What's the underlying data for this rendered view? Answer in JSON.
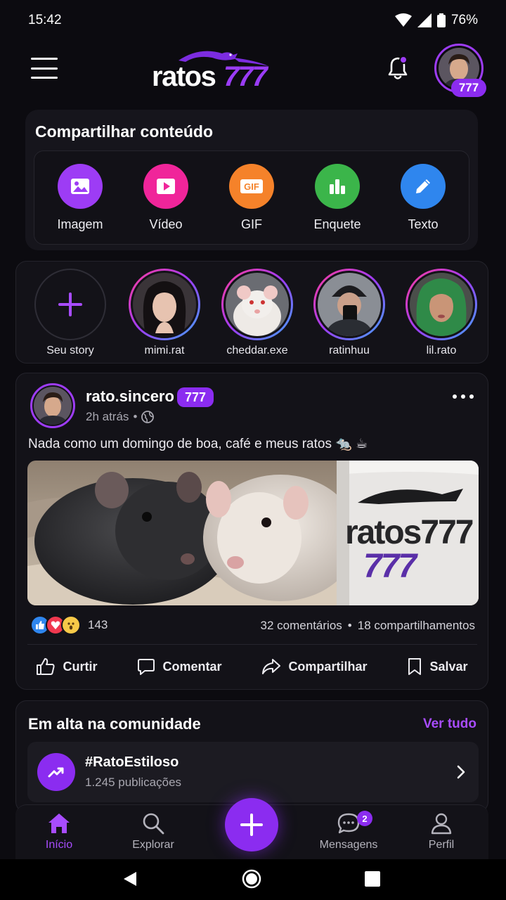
{
  "status_bar": {
    "time": "15:42",
    "battery": "76%"
  },
  "header": {
    "brand": "ratos777",
    "level": "777",
    "notification_dot": true
  },
  "share": {
    "title": "Compartilhar conteúdo",
    "options": [
      {
        "label": "Imagem",
        "icon": "image-icon",
        "color": "#9d3cf5"
      },
      {
        "label": "Vídeo",
        "icon": "play-icon",
        "color": "#f0259a"
      },
      {
        "label": "GIF",
        "icon": "gif-icon",
        "color": "#f5822a"
      },
      {
        "label": "Enquete",
        "icon": "bar-chart-icon",
        "color": "#3bb54a"
      },
      {
        "label": "Texto",
        "icon": "pencil-icon",
        "color": "#2f86ee"
      }
    ]
  },
  "stories": [
    {
      "label": "Seu story"
    },
    {
      "label": "mimi.rat"
    },
    {
      "label": "cheddar.exe"
    },
    {
      "label": "ratinhuu"
    },
    {
      "label": "lil.rato"
    }
  ],
  "post": {
    "username": "rato.sincero",
    "badge": "777",
    "time": "2h atrás",
    "separator": "•",
    "text": "Nada como um domingo de boa, café e meus ratos 🐀 ☕",
    "mug_brand": "ratos777",
    "mug_number": "777",
    "reactions_count": "143",
    "comments": "32 comentários",
    "shares": "18 compartilhamentos",
    "actions": {
      "like": "Curtir",
      "comment": "Comentar",
      "share": "Compartilhar",
      "save": "Salvar"
    }
  },
  "trending": {
    "title": "Em alta na comunidade",
    "see_all": "Ver tudo",
    "item": {
      "tag": "#RatoEstiloso",
      "count": "1.245 publicações"
    }
  },
  "bottom_nav": {
    "home": "Início",
    "explore": "Explorar",
    "messages": "Mensagens",
    "messages_badge": "2",
    "profile": "Perfil"
  },
  "colors": {
    "accent": "#8b2cf0",
    "accent_text": "#a84cff",
    "background": "#0c0b10"
  }
}
